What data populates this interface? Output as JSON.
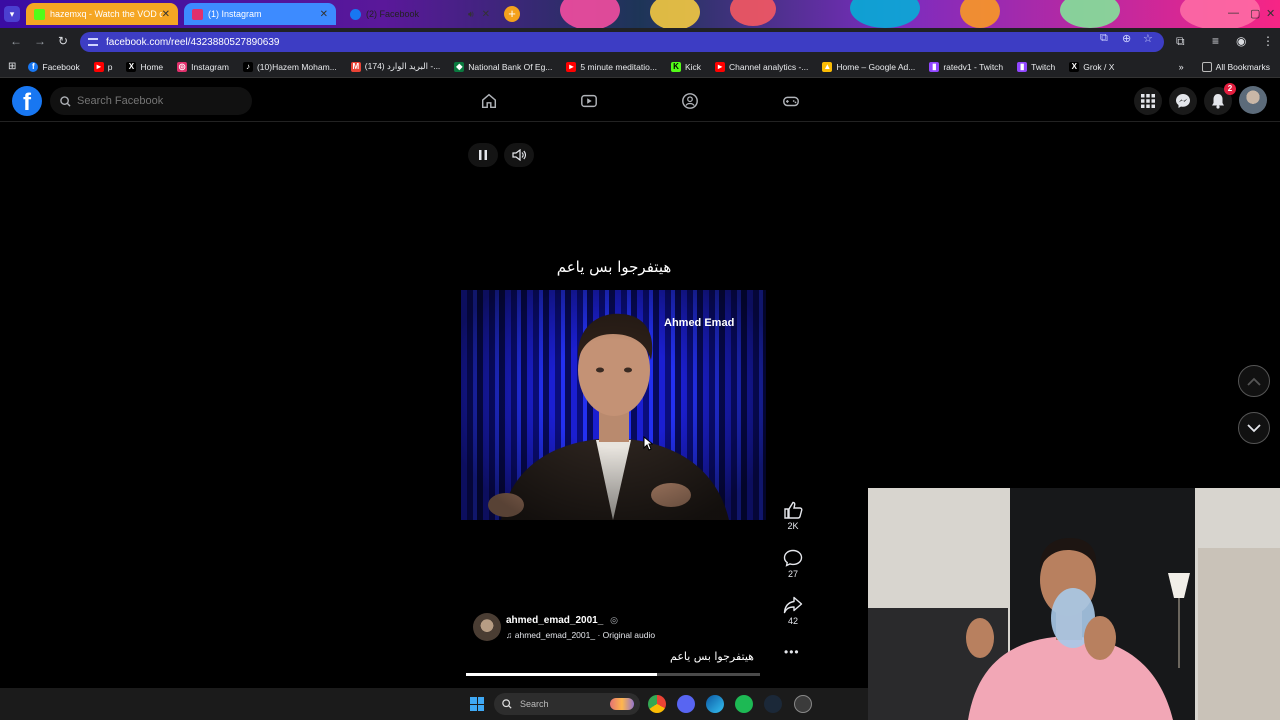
{
  "browser": {
    "tabs": [
      {
        "label": "hazemxq - Watch the VOD on",
        "icon_color": "#53fc18",
        "bg": "#f5a623",
        "active": false
      },
      {
        "label": "(1) Instagram",
        "icon_color": "#e1306c",
        "bg": "#3d8bff",
        "active": false
      },
      {
        "label": "(2) Facebook",
        "icon_color": "#1877f2",
        "bg": "transparent",
        "active": true
      }
    ],
    "url": "facebook.com/reel/4323880527890639",
    "bookmarks": [
      {
        "label": "Facebook",
        "icon": "facebook-icon",
        "color": "#1877f2"
      },
      {
        "label": "p",
        "icon": "youtube-icon",
        "color": "#ff0000"
      },
      {
        "label": "Home",
        "icon": "x-icon",
        "color": "#000000"
      },
      {
        "label": "Instagram",
        "icon": "instagram-icon",
        "color": "#e1306c"
      },
      {
        "label": "(10)Hazem Moham...",
        "icon": "tiktok-icon",
        "color": "#000000"
      },
      {
        "label": "(174) البريد الوارد -...",
        "icon": "gmail-icon",
        "color": "#ea4335"
      },
      {
        "label": "National Bank Of Eg...",
        "icon": "bank-icon",
        "color": "#0a7a3f"
      },
      {
        "label": "5 minute meditatio...",
        "icon": "youtube-icon",
        "color": "#ff0000"
      },
      {
        "label": "Kick",
        "icon": "kick-icon",
        "color": "#53fc18"
      },
      {
        "label": "Channel analytics -...",
        "icon": "youtube-icon",
        "color": "#ff0000"
      },
      {
        "label": "Home – Google Ad...",
        "icon": "google-ads-icon",
        "color": "#fbbc04"
      },
      {
        "label": "ratedv1 - Twitch",
        "icon": "twitch-icon",
        "color": "#9146ff"
      },
      {
        "label": "Twitch",
        "icon": "twitch-icon",
        "color": "#9146ff"
      },
      {
        "label": "Grok / X",
        "icon": "x-icon",
        "color": "#000000"
      }
    ],
    "all_bookmarks": "All Bookmarks"
  },
  "facebook": {
    "logo": "f",
    "search_placeholder": "Search Facebook",
    "notification_count": "2"
  },
  "reel": {
    "caption_top": "هيتفرجوا بس ياعم",
    "speaker_name": "Ahmed Emad",
    "likes": "2K",
    "comments": "27",
    "shares": "42",
    "author": "ahmed_emad_2001_",
    "audio": "ahmed_emad_2001_ · Original audio",
    "caption_bottom": "هيتفرجوا بس ياعم",
    "progress_fraction": 0.65
  },
  "taskbar": {
    "search_label": "Search"
  },
  "colors": {
    "fb_blue": "#1877f2",
    "omnibox": "#3d3dc4",
    "notif_red": "#e41e3f"
  }
}
